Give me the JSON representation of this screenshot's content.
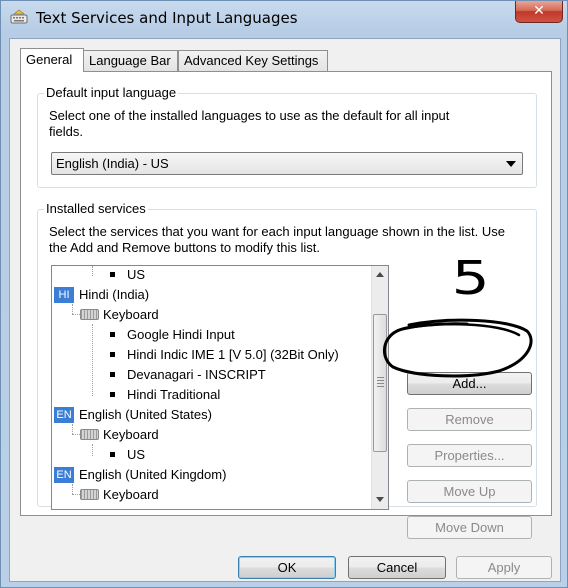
{
  "window": {
    "title": "Text Services and Input Languages",
    "close_label": "✕"
  },
  "tabs": [
    {
      "label": "General",
      "active": true
    },
    {
      "label": "Language Bar",
      "active": false
    },
    {
      "label": "Advanced Key Settings",
      "active": false
    }
  ],
  "default_language": {
    "group_label": "Default input language",
    "description_line1": "Select one of the installed languages to use as the default for all input",
    "description_line2": "fields.",
    "selected": "English (India) - US"
  },
  "installed_services": {
    "group_label": "Installed services",
    "description_line1": "Select the services that you want for each input language shown in the list. Use",
    "description_line2": "the Add and Remove buttons to modify this list.",
    "tree": [
      {
        "kind": "service",
        "text": "US"
      },
      {
        "kind": "language",
        "badge": "HI",
        "text": "Hindi (India)"
      },
      {
        "kind": "category",
        "text": "Keyboard"
      },
      {
        "kind": "service",
        "text": "Google Hindi Input"
      },
      {
        "kind": "service",
        "text": "Hindi Indic IME 1 [V 5.0] (32Bit Only)"
      },
      {
        "kind": "service",
        "text": "Devanagari - INSCRIPT"
      },
      {
        "kind": "service",
        "text": "Hindi Traditional"
      },
      {
        "kind": "language",
        "badge": "EN",
        "text": "English (United States)"
      },
      {
        "kind": "category",
        "text": "Keyboard"
      },
      {
        "kind": "service",
        "text": "US"
      },
      {
        "kind": "language",
        "badge": "EN",
        "text": "English (United Kingdom)"
      },
      {
        "kind": "category",
        "text": "Keyboard"
      }
    ],
    "buttons": {
      "add": "Add...",
      "remove": "Remove",
      "properties": "Properties...",
      "move_up": "Move Up",
      "move_down": "Move Down"
    }
  },
  "annotation": {
    "text": "5"
  },
  "footer": {
    "ok": "OK",
    "cancel": "Cancel",
    "apply": "Apply"
  },
  "colors": {
    "lang_badge": "#3a7fd5",
    "annotation_ink": "#000000"
  }
}
